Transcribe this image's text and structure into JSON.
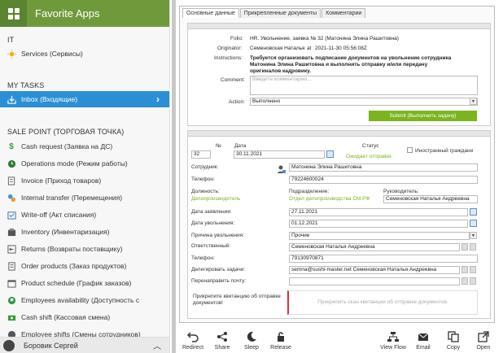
{
  "app": {
    "title": "Favorite Apps"
  },
  "sidebar": {
    "sections": [
      {
        "label": "IT"
      },
      {
        "label": "MY TASKS"
      },
      {
        "label": "SALE POINT (ТОРГОВАЯ ТОЧКА)"
      }
    ],
    "items": [
      {
        "label": "Services (Сервисы)",
        "icon": "sun-icon"
      },
      {
        "label": "Inbox (Входящие)",
        "icon": "inbox-icon"
      },
      {
        "label": "Cash request (Заявка на ДС)",
        "icon": "dollar-icon"
      },
      {
        "label": "Operations mode (Режим работы)",
        "icon": "clock-icon"
      },
      {
        "label": "Invoice (Приход товаров)",
        "icon": "document-icon"
      },
      {
        "label": "Internal transfer (Перемещения)",
        "icon": "transfer-icon"
      },
      {
        "label": "Write-off (Акт списания)",
        "icon": "writeoff-icon"
      },
      {
        "label": "Inventory (Инвентаризация)",
        "icon": "inventory-icon"
      },
      {
        "label": "Returns (Возвраты поставщику)",
        "icon": "return-icon"
      },
      {
        "label": "Order products (Заказ продуктов)",
        "icon": "cart-icon"
      },
      {
        "label": "Product schedule (График заказов)",
        "icon": "calendar-icon"
      },
      {
        "label": "Employees availability (Доступность с",
        "icon": "employees-icon"
      },
      {
        "label": "Cash shift (Кассовая смена)",
        "icon": "cash-icon"
      },
      {
        "label": "Employee shifts (Смены сотрудников)",
        "icon": "shifts-icon"
      }
    ],
    "user": "Боровик Сергей"
  },
  "tabs": [
    {
      "label": "Основные данные"
    },
    {
      "label": "Прикрепленные документы"
    },
    {
      "label": "Комментарии"
    }
  ],
  "task": {
    "folio_label": "Folio:",
    "folio": "HR. Увольнение, заявка № 32 (Матонина Элина Рашитовна)",
    "originator_label": "Originator:",
    "originator": "Семеновская Наталья",
    "originator_at": "at",
    "originator_time": "2021-11-30 05:56:08Z",
    "instructions_label": "Instructions:",
    "instructions": [
      "Требуется организовать подписание документов на увольнение сотрудника",
      "Матонина Элина Рашитовна и выполнить отправку и/или передачу",
      "оригиналов кадровику."
    ],
    "comment_label": "Comment:",
    "comment_placeholder": "Введите комментарии...",
    "action_label": "Action:",
    "action_value": "Выполнено",
    "submit_label": "Submit (Выполнить задачу)"
  },
  "form": {
    "num_label": "№",
    "num": "32",
    "date_label": "Дата",
    "date": "30.11.2021",
    "status_label": "Статус",
    "status": "Ожидает отправки",
    "foreign_label": "Иностранный граждани",
    "employee_label": "Сотрудник:",
    "employee": "Матонина Элина Рашитовна",
    "phone_label": "Телефон:",
    "phone": "79224600024",
    "position_label": "Должность:",
    "position": "Делопроизводитель",
    "department_label": "Подразделение:",
    "department": "Отдел делопроизводства СМ РФ",
    "manager_label": "Руководитель:",
    "manager": "Семеновская Наталья Андреевна",
    "request_date_label": "Дата заявления:",
    "request_date": "27.11.2021",
    "dismiss_date_label": "Дата увольнения:",
    "dismiss_date": "01.12.2021",
    "reason_label": "Причина увольнения:",
    "reason": "Прочие",
    "responsible_label": "Ответственный:",
    "responsible": "Семеновская Наталья Андреевна",
    "phone2_label": "Телефон:",
    "phone2": "79130970871",
    "delegate_label": "Делегировать задачи:",
    "delegate": "semna@sushi-master.net Семеновская Наталья Андреевна",
    "redirect_mail_label": "Перенаправить почту:",
    "attach_label": "Прикрепите квитанцию об отправке документов!",
    "attach_placeholder": "Прикрепить скан квитанции об отправке документов."
  },
  "toolbar": [
    {
      "label": "Redirect",
      "icon": "redirect-icon"
    },
    {
      "label": "Share",
      "icon": "share-icon"
    },
    {
      "label": "Sleep",
      "icon": "moon-icon"
    },
    {
      "label": "Release",
      "icon": "release-icon"
    },
    {
      "label": "View Flow",
      "icon": "flow-icon"
    },
    {
      "label": "Email",
      "icon": "email-icon"
    },
    {
      "label": "Copy",
      "icon": "copy-icon"
    },
    {
      "label": "Open",
      "icon": "open-icon"
    }
  ],
  "colors": {
    "header": "#6f9a3b",
    "active": "#2b8fd6",
    "link": "#7ab51d"
  }
}
